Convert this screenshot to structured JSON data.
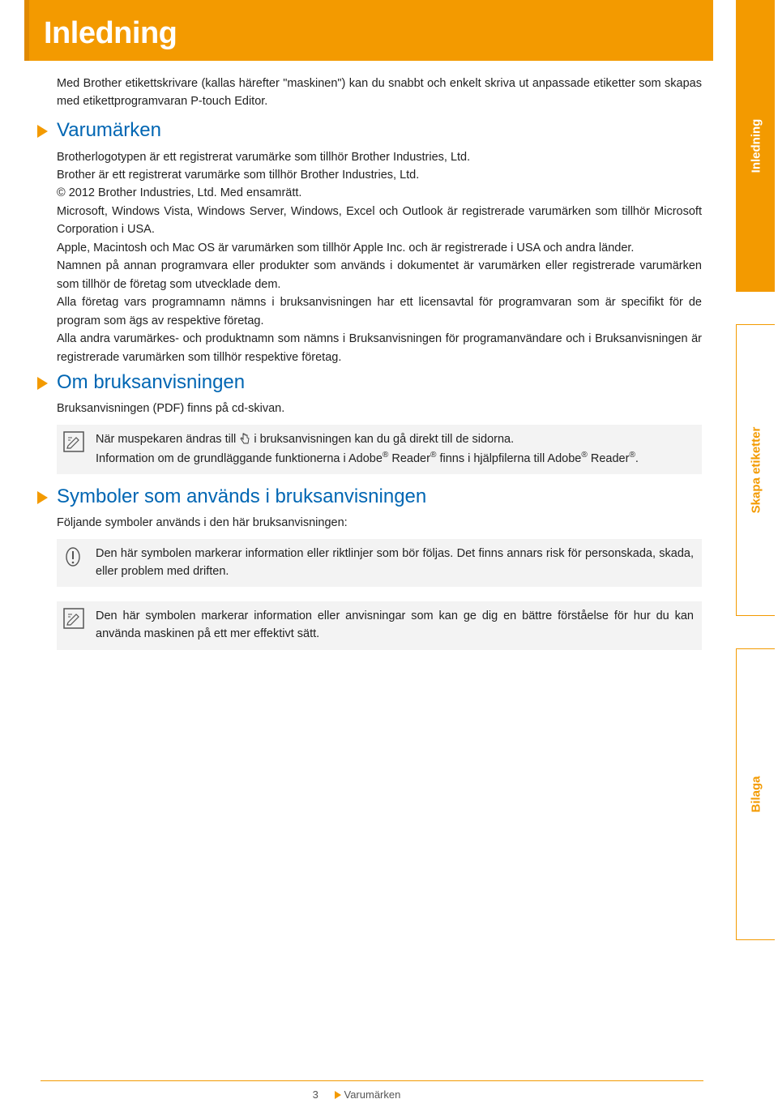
{
  "title": "Inledning",
  "intro": "Med Brother etikettskrivare (kallas härefter \"maskinen\") kan du snabbt och enkelt skriva ut anpassade etiketter som skapas med etikettprogramvaran P-touch Editor.",
  "section1": {
    "heading": "Varumärken",
    "p1": "Brotherlogotypen är ett registrerat varumärke som tillhör Brother Industries, Ltd.",
    "p2": "Brother är ett registrerat varumärke som tillhör Brother Industries, Ltd.",
    "p3": "© 2012 Brother Industries, Ltd. Med ensamrätt.",
    "p4": "Microsoft, Windows Vista, Windows Server, Windows, Excel och Outlook är registrerade varumärken som tillhör Microsoft Corporation i USA.",
    "p5": "Apple, Macintosh och Mac OS är varumärken som tillhör Apple Inc. och är registrerade i USA och andra länder.",
    "p6": "Namnen på annan programvara eller produkter som används i dokumentet är varumärken eller registrerade varumärken som tillhör de företag som utvecklade dem.",
    "p7": "Alla företag vars programnamn nämns i bruksanvisningen har ett licensavtal för programvaran som är specifikt för de program som ägs av respektive företag.",
    "p8": "Alla andra varumärkes- och produktnamn som nämns i Bruksanvisningen för programanvändare och i Bruksanvisningen är registrerade varumärken som tillhör respektive företag."
  },
  "section2": {
    "heading": "Om bruksanvisningen",
    "lead": "Bruksanvisningen (PDF) finns på cd-skivan.",
    "note_a": "När muspekaren ändras till ",
    "note_b": " i bruksanvisningen kan du gå direkt till de sidorna.",
    "note_c1": "Information om de grundläggande funktionerna i Adobe",
    "note_c2": " Reader",
    "note_c3": " finns i hjälpfilerna till Adobe",
    "note_c4": " Reader",
    "note_c5": "."
  },
  "section3": {
    "heading": "Symboler som används i bruksanvisningen",
    "lead": "Följande symboler används i den här bruksanvisningen:",
    "warn": "Den här symbolen markerar information eller riktlinjer som bör följas. Det finns annars risk för personskada, skada, eller problem med driften.",
    "tip": "Den här symbolen markerar information eller anvisningar som kan ge dig en bättre förståelse för hur du kan använda maskinen på ett mer effektivt sätt."
  },
  "tabs": {
    "t1": "Inledning",
    "t2": "Skapa etiketter",
    "t3": "Bilaga"
  },
  "footer": {
    "page": "3",
    "crumb": "Varumärken"
  }
}
